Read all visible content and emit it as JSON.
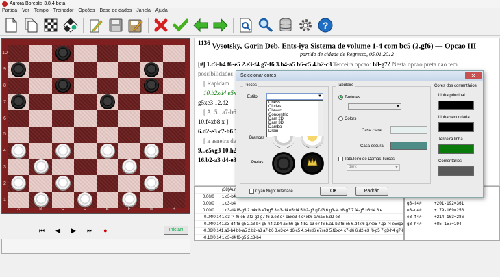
{
  "window": {
    "title": "Aurora Borealis 3.8.4 beta"
  },
  "menu": [
    "Partida",
    "Ver",
    "Tempo",
    "Treinador",
    "Opções",
    "Base de dados",
    "Janela",
    "Ajuda"
  ],
  "toolbar_icons": [
    "new-document-icon",
    "copy-document-icon",
    "board-icon",
    "board-setup-icon",
    "edit-icon",
    "save-disk-icon",
    "save-edit-icon",
    "delete-x-icon",
    "check-icon",
    "arrow-left-icon",
    "arrow-right-icon",
    "search-document-icon",
    "search-icon",
    "database-icon",
    "gear-icon",
    "help-icon"
  ],
  "board": {
    "ranks": [
      "10",
      "9",
      "8",
      "7",
      "6",
      "5",
      "4",
      "3",
      "2",
      "1"
    ],
    "files": [
      "A",
      "B",
      "C",
      "D",
      "E",
      "F",
      "G",
      "H"
    ],
    "pieces": [
      "..b.....",
      "b.....b.",
      "..b...b.",
      "b...b...",
      "........",
      "........",
      "w.w.w.w.",
      ".w...w..",
      "w.w...w.",
      ".w.w.w.."
    ]
  },
  "nav": {
    "first": "⏮",
    "prev": "◀",
    "next": "▶",
    "last": "⏭",
    "init_label": "Iniciar!"
  },
  "notation": {
    "game_no": "1136",
    "title": "Vysotsky, Gorin Deb. Ents-iya Sistema de volume 1-4 com bc5 (2.gf6) — Opcao III",
    "subtitle": "partido de cidade de Regresso, 05.01.2012",
    "line1": "[#] 1.c3-b4 f6-e5 2.e3-f4 g7-f6 3.b4-a5 b6-c5 4.b2-c3",
    "line1b": " Terceira opcao: ",
    "line1c": "h8-g7?",
    "line1d": " Nesta opcao preta nao tem",
    "line2": "possibilidades",
    "line3": "[ Rapidam",
    "line4": "10.b2xd4 e5x",
    "line5": "g5xe3 12.d2",
    "line6": "[ Ai 5...a7-b6",
    "line7": "10.f4xb8 x ]",
    "line8": "6.d2-e3 c7-b6 7",
    "line9": "[ a asneira de",
    "line10": "9...e5xg3 10.h2",
    "line11": "16.b2-a3 d4-e3"
  },
  "engine": {
    "header": "(38)Aur",
    "rows": [
      {
        "score": "0.00/0",
        "line": "1.c3-b4"
      },
      {
        "score": "0.00/0",
        "line": "1.c3-b4"
      },
      {
        "score": "0.00/0",
        "line": "1.c3-d4 f6-g5 2.h4xf6 e7xg5 3.c3-d4 e5xf4 5.h2-g3 g7-f6 6.g3-f4 h8-g7 7.f4-g5 h6xf4 8.e"
      },
      {
        "score": "-0.04/0.14",
        "line": "1.e3-f4 f6-e5 2.f2-g3 g7-f6 3.e3-d4 c5xe3 4.d4xb6 c7xa5 5.d2-e3"
      },
      {
        "score": "-0.04/0.14",
        "line": "1.e3-d4 f6-g5 2.c3-b4 g5-h4 3.b4-a5 h6-g5 4.b2-c3 e7-f6 5.a1-b2 f6-e5 6.d4xf6 g7xe5 7.g3-f4 e5xg3"
      },
      {
        "score": "-0.06/0.14",
        "line": "1.a3-b4 b6-a5 2.b2-a3 a7-b6 3.e3-d4 d6-c5 4.b4xd6 e7xe3 5.f2xd4 c7-d6 6.d2-e3 f6-g5 7.g3-h4 g7-h6"
      },
      {
        "score": "-0.10/0.14",
        "line": "1.c3-d4 f6-g5 2.c3-b4"
      }
    ]
  },
  "side_moves": [
    {
      "m": "c3-b4#",
      "s": "+1=6-1"
    },
    {
      "m": "c3-d4#",
      "s": "+188-338=296"
    },
    {
      "m": "g3-f4#",
      "s": "+201-192=361"
    },
    {
      "m": "e3-d4#",
      "s": "+179-169=256"
    },
    {
      "m": "e3-f4#",
      "s": "+214-163=286"
    },
    {
      "m": "g3-h4#",
      "s": "+85-157=194"
    }
  ],
  "dialog": {
    "title": "Selecionar cores",
    "close": "✕",
    "pieces_group": "Pieces",
    "style_label": "Estilo",
    "style_value": "",
    "style_options": [
      "Chess",
      "Circles",
      "Classic",
      "Concentric",
      "Dam 2D",
      "Dam 3D",
      "Dambo",
      "Drain"
    ],
    "whites_label": "Brancas",
    "blacks_label": "Pretas",
    "board_group": "Tabuleiro",
    "textures_label": "Textures",
    "colors_label": "Colors",
    "light_label": "Casa clara",
    "dark_label": "Casa escura",
    "turkish_label": "Tabuleiro de Damas Turcas",
    "turkish_value": "dark",
    "comments_group": "Cores dos comentários",
    "main_line_label": "Linha principal",
    "secondary_line_label": "Linha secundária",
    "third_line_label": "Terceira linha",
    "comments_label": "Comentários",
    "cyan_label": "Cyan Night Interface",
    "ok_label": "OK",
    "default_label": "Padrão",
    "colors": {
      "light_square": "#e6f0ee",
      "dark_square": "#4e8c88",
      "main_line": "#000000",
      "secondary_line": "#000000",
      "third_line": "#0a7a0a",
      "comments": "#595959"
    }
  }
}
